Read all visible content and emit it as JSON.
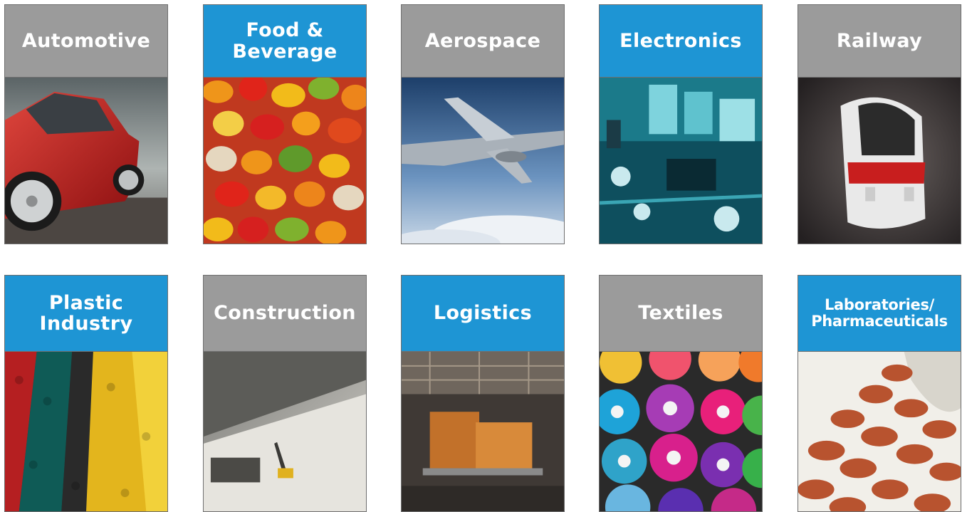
{
  "industries": [
    {
      "label": "Automotive",
      "header_color": "#9b9b9b",
      "image_icon": "red-car-photo"
    },
    {
      "label": "Food &\nBeverage",
      "header_color": "#1e95d4",
      "image_icon": "gummy-bears-photo"
    },
    {
      "label": "Aerospace",
      "header_color": "#9b9b9b",
      "image_icon": "airplane-photo"
    },
    {
      "label": "Electronics",
      "header_color": "#1e95d4",
      "image_icon": "circuit-board-photo"
    },
    {
      "label": "Railway",
      "header_color": "#9b9b9b",
      "image_icon": "high-speed-train-photo"
    },
    {
      "label": "Plastic\nIndustry",
      "header_color": "#1e95d4",
      "image_icon": "plastic-pellets-photo"
    },
    {
      "label": "Construction",
      "header_color": "#9b9b9b",
      "image_icon": "excavator-quarry-photo"
    },
    {
      "label": "Logistics",
      "header_color": "#1e95d4",
      "image_icon": "warehouse-crates-photo"
    },
    {
      "label": "Textiles",
      "header_color": "#9b9b9b",
      "image_icon": "thread-spools-photo"
    },
    {
      "label": "Laboratories/\nPharmaceuticals",
      "header_color": "#1e95d4",
      "image_icon": "pills-photo"
    }
  ]
}
